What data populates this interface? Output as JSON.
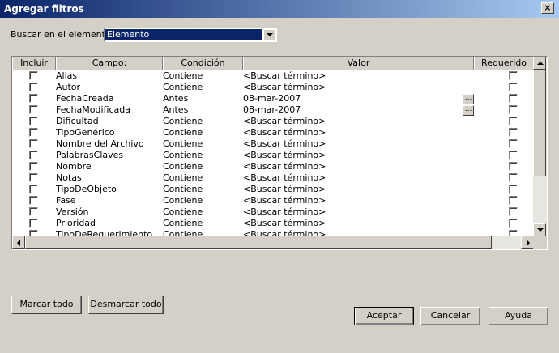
{
  "window": {
    "title": "Agregar filtros",
    "close": "×"
  },
  "search": {
    "label": "Buscar en el elemento:",
    "value": "Elemento"
  },
  "grid": {
    "columns": {
      "include": "Incluir",
      "field": "Campo:",
      "condition": "Condición",
      "value": "Valor",
      "required": "Requerido"
    },
    "rows": [
      {
        "field": "Alias",
        "condition": "Contiene",
        "value": "<Buscar término>",
        "has_picker": false
      },
      {
        "field": "Autor",
        "condition": "Contiene",
        "value": "<Buscar término>",
        "has_picker": false
      },
      {
        "field": "FechaCreada",
        "condition": "Antes",
        "value": "08-mar-2007",
        "has_picker": true
      },
      {
        "field": "FechaModificada",
        "condition": "Antes",
        "value": "08-mar-2007",
        "has_picker": true
      },
      {
        "field": "Dificultad",
        "condition": "Contiene",
        "value": "<Buscar término>",
        "has_picker": false
      },
      {
        "field": "TipoGenérico",
        "condition": "Contiene",
        "value": "<Buscar término>",
        "has_picker": false
      },
      {
        "field": "Nombre del Archivo",
        "condition": "Contiene",
        "value": "<Buscar término>",
        "has_picker": false
      },
      {
        "field": "PalabrasClaves",
        "condition": "Contiene",
        "value": "<Buscar término>",
        "has_picker": false
      },
      {
        "field": "Nombre",
        "condition": "Contiene",
        "value": "<Buscar término>",
        "has_picker": false
      },
      {
        "field": "Notas",
        "condition": "Contiene",
        "value": "<Buscar término>",
        "has_picker": false
      },
      {
        "field": "TipoDeObjeto",
        "condition": "Contiene",
        "value": "<Buscar término>",
        "has_picker": false
      },
      {
        "field": "Fase",
        "condition": "Contiene",
        "value": "<Buscar término>",
        "has_picker": false
      },
      {
        "field": "Versión",
        "condition": "Contiene",
        "value": "<Buscar término>",
        "has_picker": false
      },
      {
        "field": "Prioridad",
        "condition": "Contiene",
        "value": "<Buscar término>",
        "has_picker": false
      },
      {
        "field": "TipoDeRequerimiento",
        "condition": "Contiene",
        "value": "<Buscar término>",
        "has_picker": false
      }
    ],
    "picker_label": "..."
  },
  "buttons": {
    "mark_all": "Marcar todo",
    "unmark_all": "Desmarcar todo",
    "accept": "Aceptar",
    "cancel": "Cancelar",
    "help": "Ayuda"
  }
}
